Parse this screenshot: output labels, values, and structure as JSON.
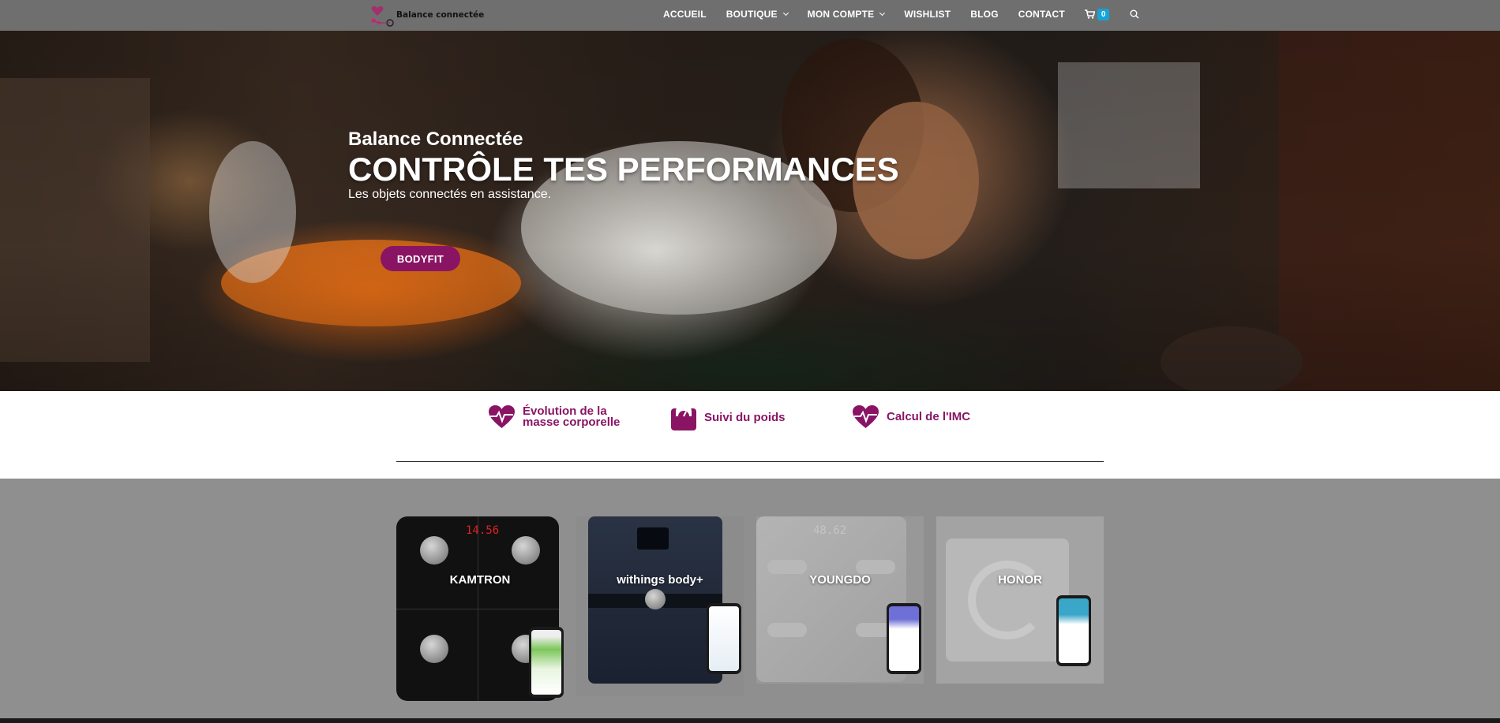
{
  "header": {
    "logo_text": "Balance connectée",
    "nav": {
      "accueil": "ACCUEIL",
      "boutique": "BOUTIQUE",
      "mon_compte": "MON COMPTE",
      "wishlist": "WISHLIST",
      "blog": "BLOG",
      "contact": "CONTACT"
    },
    "cart_count": "0"
  },
  "hero": {
    "subtitle": "Balance Connectée",
    "title": "CONTRÔLE TES PERFORMANCES",
    "tagline": "Les objets connectés en assistance.",
    "button_label": "BODYFIT"
  },
  "features": [
    {
      "label_line1": "Évolution de la",
      "label_line2": "masse corporelle",
      "icon": "heartbeat-icon"
    },
    {
      "label": "Suivi du poids",
      "icon": "scale-icon"
    },
    {
      "label": "Calcul de l'IMC",
      "icon": "heartbeat-icon"
    }
  ],
  "products": [
    {
      "name": "KAMTRON",
      "display": "14.56"
    },
    {
      "name": "withings body+"
    },
    {
      "name": "YOUNGDO",
      "display": "48.62"
    },
    {
      "name": "HONOR"
    }
  ],
  "colors": {
    "brand": "#8a1464",
    "cart_badge": "#16a4d8",
    "header_bg": "#6f6f6f"
  }
}
